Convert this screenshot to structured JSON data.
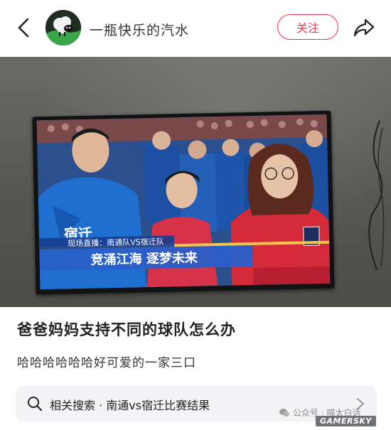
{
  "header": {
    "username": "一瓶快乐的汽水",
    "follow_label": "关注"
  },
  "photo": {
    "tv_caption_small": "现场直播：南通队VS宿迁队",
    "tv_caption_main": "竞涌江海  逐梦未来",
    "jersey_text": "宿迁"
  },
  "post": {
    "title": "爸爸妈妈支持不同的球队怎么办",
    "body": "哈哈哈哈哈哈好可爱的一家三口"
  },
  "related": {
    "label": "相关搜索 · 南通vs宿迁比赛结果"
  },
  "watermark": {
    "text": "公众号 · 喵太白话",
    "brand": "GAMERSKY"
  },
  "colors": {
    "accent": "#ff2e4d",
    "jersey_blue": "#1e6fd0",
    "jersey_red": "#d42a3a"
  }
}
